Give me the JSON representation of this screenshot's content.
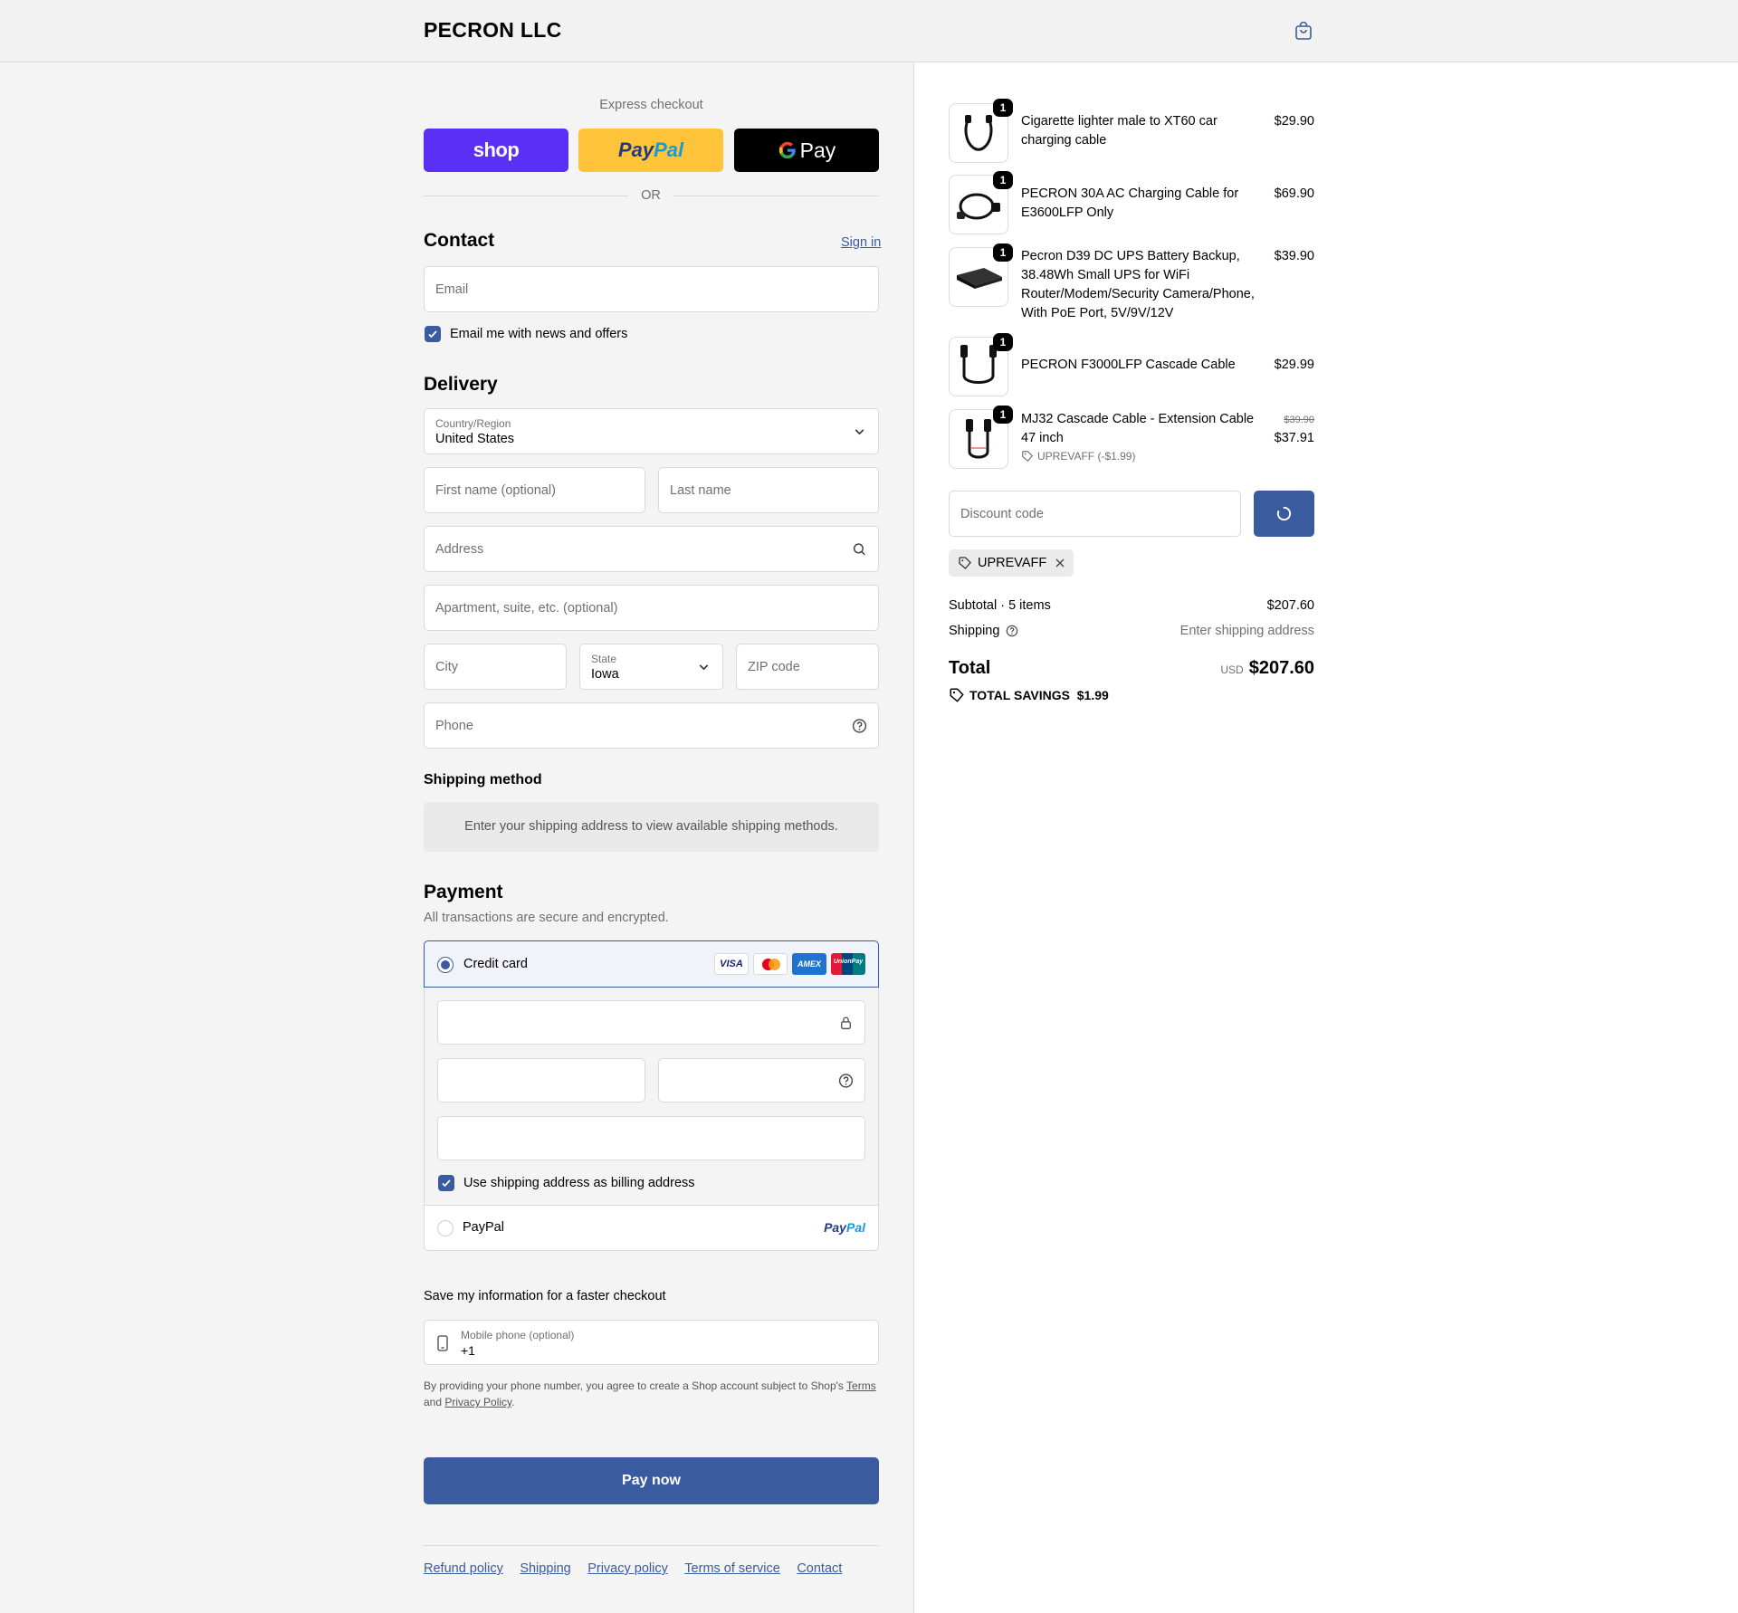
{
  "header": {
    "brand": "PECRON LLC",
    "cart_icon": "shopping-bag-icon"
  },
  "express": {
    "title": "Express checkout",
    "shop_label": "shop",
    "paypal_label_a": "Pay",
    "paypal_label_b": "Pal",
    "gpay_label": "Pay",
    "or_label": "OR",
    "colors": {
      "shop": "#5a31f4",
      "paypal": "#ffc439",
      "gpay": "#000000"
    }
  },
  "contact": {
    "title": "Contact",
    "signin": "Sign in",
    "email_placeholder": "Email",
    "newsletter_label": "Email me with news and offers"
  },
  "delivery": {
    "title": "Delivery",
    "country_label": "Country/Region",
    "country_value": "United States",
    "first_name": "First name (optional)",
    "last_name": "Last name",
    "address": "Address",
    "apartment": "Apartment, suite, etc. (optional)",
    "city": "City",
    "state_label": "State",
    "state_value": "Iowa",
    "zip": "ZIP code",
    "phone": "Phone"
  },
  "shipping_method": {
    "title": "Shipping method",
    "message": "Enter your shipping address to view available shipping methods."
  },
  "payment": {
    "title": "Payment",
    "subtitle": "All transactions are secure and encrypted.",
    "credit_card_label": "Credit card",
    "card_logos": [
      "VISA",
      "mastercard",
      "AMEX",
      "UnionPay"
    ],
    "billing_label": "Use shipping address as billing address",
    "paypal_option": "PayPal",
    "paypal_logo_a": "Pay",
    "paypal_logo_b": "Pal"
  },
  "save_info": {
    "title": "Save my information for a faster checkout",
    "mobile_label": "Mobile phone (optional)",
    "mobile_value": "+1",
    "disclaimer_a": "By providing your phone number, you agree to create a Shop account subject to Shop's ",
    "terms": "Terms",
    "disclaimer_b": "and ",
    "privacy": "Privacy Policy",
    "disclaimer_c": "."
  },
  "pay_now": "Pay now",
  "footer": [
    "Refund policy",
    "Shipping",
    "Privacy policy",
    "Terms of service",
    "Contact"
  ],
  "cart": {
    "items": [
      {
        "name": "Cigarette lighter male to XT60 car charging cable",
        "price": "$29.90",
        "qty": "1"
      },
      {
        "name": "PECRON 30A AC Charging Cable for E3600LFP Only",
        "price": "$69.90",
        "qty": "1"
      },
      {
        "name": "Pecron D39 DC UPS Battery Backup, 38.48Wh Small UPS for WiFi Router/Modem/Security Camera/Phone, With PoE Port, 5V/9V/12V",
        "price": "$39.90",
        "qty": "1"
      },
      {
        "name": "PECRON F3000LFP Cascade Cable",
        "price": "$29.99",
        "qty": "1"
      },
      {
        "name": "MJ32 Cascade Cable - Extension Cable 47 inch",
        "price": "$37.91",
        "original_price": "$39.90",
        "discount": "UPREVAFF (-$1.99)",
        "qty": "1"
      }
    ],
    "discount_placeholder": "Discount code",
    "applied_code": "UPREVAFF",
    "subtotal_label": "Subtotal · 5 items",
    "subtotal_value": "$207.60",
    "shipping_label": "Shipping",
    "shipping_value": "Enter shipping address",
    "total_label": "Total",
    "currency": "USD",
    "total_value": "$207.60",
    "savings_label": "TOTAL SAVINGS",
    "savings_value": "$1.99",
    "accent": "#3a5ba0"
  }
}
